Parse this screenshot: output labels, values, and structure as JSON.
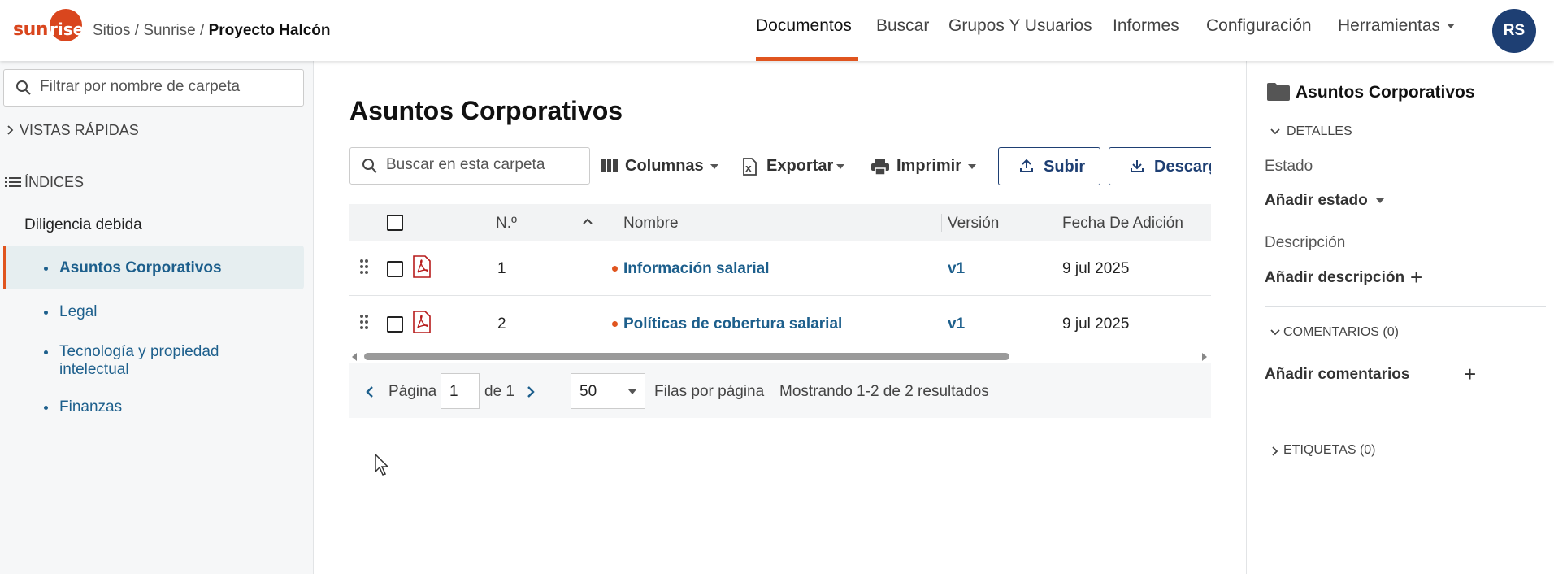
{
  "brand": {
    "logo_left": "sun",
    "logo_right": "rise",
    "accent": "#e0551f",
    "navy": "#1e3f73",
    "link": "#1d5f8c"
  },
  "header": {
    "breadcrumb": {
      "sites": "Sitios",
      "sep1": " / ",
      "site": "Sunrise",
      "sep2": " / ",
      "current": "Proyecto Halcón"
    },
    "nav": {
      "documents": "Documentos",
      "search": "Buscar",
      "groups": "Grupos Y Usuarios",
      "reports": "Informes",
      "settings": "Configuración",
      "tools": "Herramientas"
    },
    "active_nav": "Documentos",
    "avatar": "RS"
  },
  "sidebar": {
    "filter_placeholder": "Filtrar por nombre de carpeta",
    "quick_views": "VISTAS RÁPIDAS",
    "indexes": "ÍNDICES",
    "group": "Diligencia debida",
    "items": [
      {
        "label": "Asuntos Corporativos",
        "active": true
      },
      {
        "label": "Legal"
      },
      {
        "label_line1": "Tecnología y propiedad",
        "label_line2": "intelectual"
      },
      {
        "label": "Finanzas"
      }
    ]
  },
  "main": {
    "title": "Asuntos Corporativos",
    "search_placeholder": "Buscar en esta carpeta",
    "toolbar": {
      "columns": "Columnas",
      "export": "Exportar",
      "print": "Imprimir",
      "upload": "Subir",
      "download": "Descargar"
    },
    "table": {
      "headers": {
        "number": "N.º",
        "name": "Nombre",
        "version": "Versión",
        "date_added": "Fecha De Adición"
      },
      "rows": [
        {
          "number": "1",
          "name": "Información salarial",
          "version": "v1",
          "date": "9 jul 2025"
        },
        {
          "number": "2",
          "name": "Políticas de cobertura salarial",
          "version": "v1",
          "date": "9 jul 2025"
        }
      ]
    },
    "pager": {
      "page_label": "Página",
      "page_value": "1",
      "of_label": "de 1",
      "per_page_value": "50",
      "per_page_label": "Filas por página",
      "results": "Mostrando 1-2 de 2 resultados"
    }
  },
  "details": {
    "title": "Asuntos Corporativos",
    "details_section": "DETALLES",
    "status_label": "Estado",
    "status_action": "Añadir estado",
    "description_label": "Descripción",
    "description_action": "Añadir descripción",
    "comments_section": "COMENTARIOS (0)",
    "comments_action": "Añadir comentarios",
    "tags_section": "ETIQUETAS (0)"
  }
}
